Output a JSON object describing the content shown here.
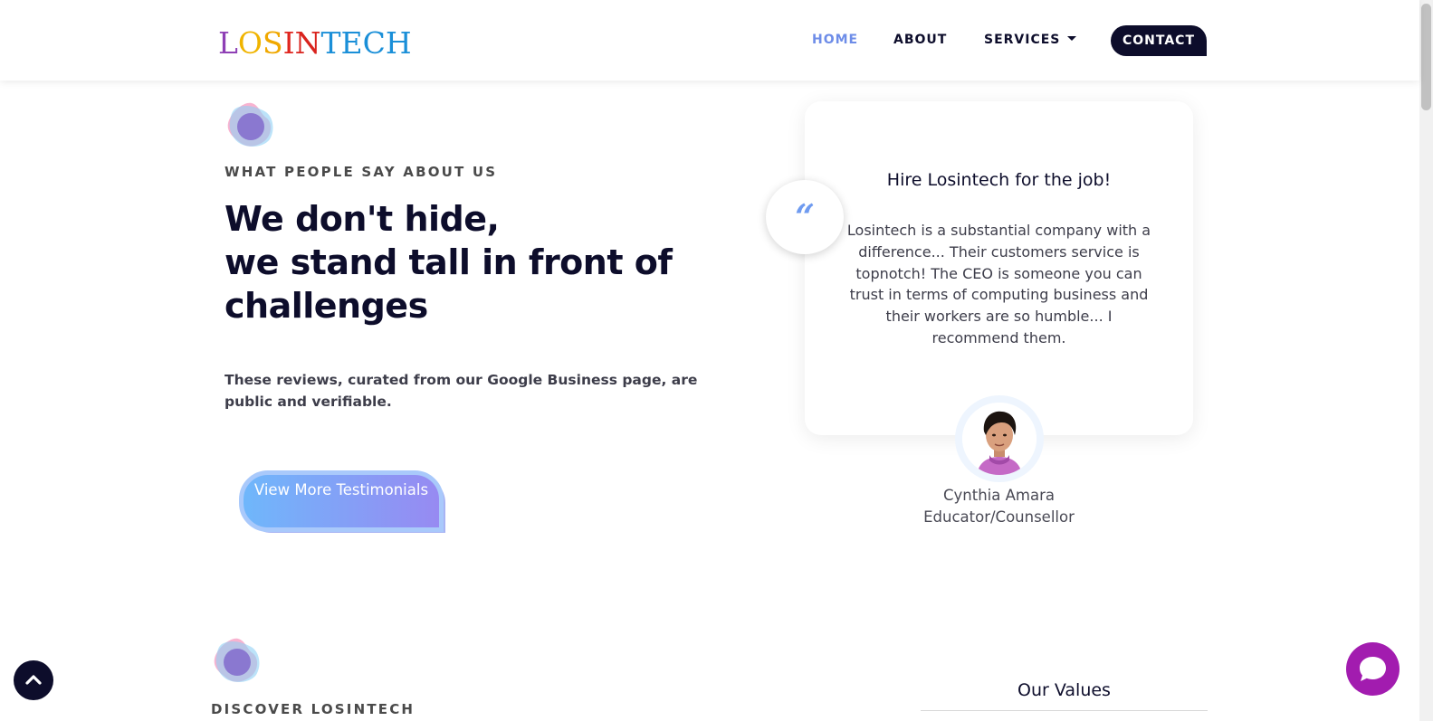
{
  "header": {
    "logo_letters": [
      {
        "char": "L",
        "color": "#8e3fb5"
      },
      {
        "char": "O",
        "color": "#f0b400"
      },
      {
        "char": "S",
        "color": "#f0a800"
      },
      {
        "char": "I",
        "color": "#e0261f"
      },
      {
        "char": "N",
        "color": "#d9231d"
      },
      {
        "char": "T",
        "color": "#1a8fd8"
      },
      {
        "char": "E",
        "color": "#1a8fd8"
      },
      {
        "char": "C",
        "color": "#1a8fd8"
      },
      {
        "char": "H",
        "color": "#1a8fd8"
      }
    ],
    "nav": {
      "home": "HOME",
      "about": "ABOUT",
      "services": "SERVICES",
      "contact": "CONTACT"
    },
    "active_color": "#6e8de8"
  },
  "testimonials": {
    "eyebrow": "WHAT PEOPLE SAY ABOUT US",
    "headline_lines": [
      "We don't hide,",
      "we stand tall in front of",
      "challenges"
    ],
    "subtext": "These reviews, curated from our Google Business page, are public and verifiable.",
    "cta_label": "View More Testimonials",
    "card": {
      "title": "Hire Losintech for the job!",
      "body": "Losintech is a substantial company with a difference... Their customers service is topnotch! The CEO is someone you can trust in terms of computing business and their workers are so humble... I recommend them.",
      "quote_glyph": "“",
      "reviewer_name": "Cynthia Amara",
      "reviewer_role": "Educator/Counsellor"
    }
  },
  "discover": {
    "eyebrow": "DISCOVER LOSINTECH",
    "values_title": "Our Values"
  },
  "icons": {
    "scroll_top": "chevron-up-icon",
    "chat": "chat-bubble-icon",
    "decor": "blob-icon"
  },
  "colors": {
    "navy": "#0d0d2b",
    "cta_gradient_start": "#6fb7fb",
    "cta_gradient_end": "#978af2",
    "chat": "#a21caf"
  }
}
